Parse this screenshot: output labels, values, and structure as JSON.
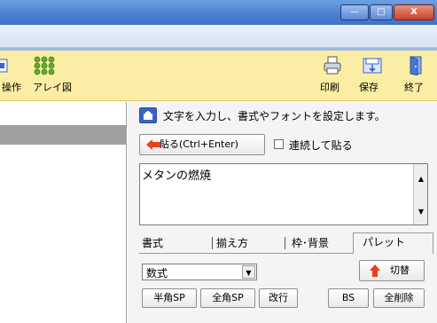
{
  "window": {
    "minimize_glyph": "—",
    "maximize_glyph": "□",
    "close_glyph": "X"
  },
  "toolbar": {
    "operation_label": "操作",
    "array_label": "アレイ図",
    "print_label": "印刷",
    "save_label": "保存",
    "exit_label": "終了"
  },
  "panel": {
    "instruction": "文字を入力し、書式やフォントを設定します。",
    "paste_button": "貼る(Ctrl+Enter)",
    "continuous_checkbox_label": "連続して貼る",
    "continuous_checked": false,
    "text_value": "メタンの燃焼",
    "tabs": [
      "書式",
      "揃え方",
      "枠･背景",
      "パレット"
    ],
    "active_tab": "パレット",
    "palette_select_value": "数式",
    "switch_button": "切替",
    "buttons": {
      "half_space": "半角SP",
      "full_space": "全角SP",
      "newline": "改行",
      "backspace": "BS",
      "delete_all": "全削除"
    }
  },
  "colors": {
    "toolbar_bg": "#fbeea4",
    "accent_red": "#e8401c",
    "panel_icon": "#3b63c4"
  }
}
